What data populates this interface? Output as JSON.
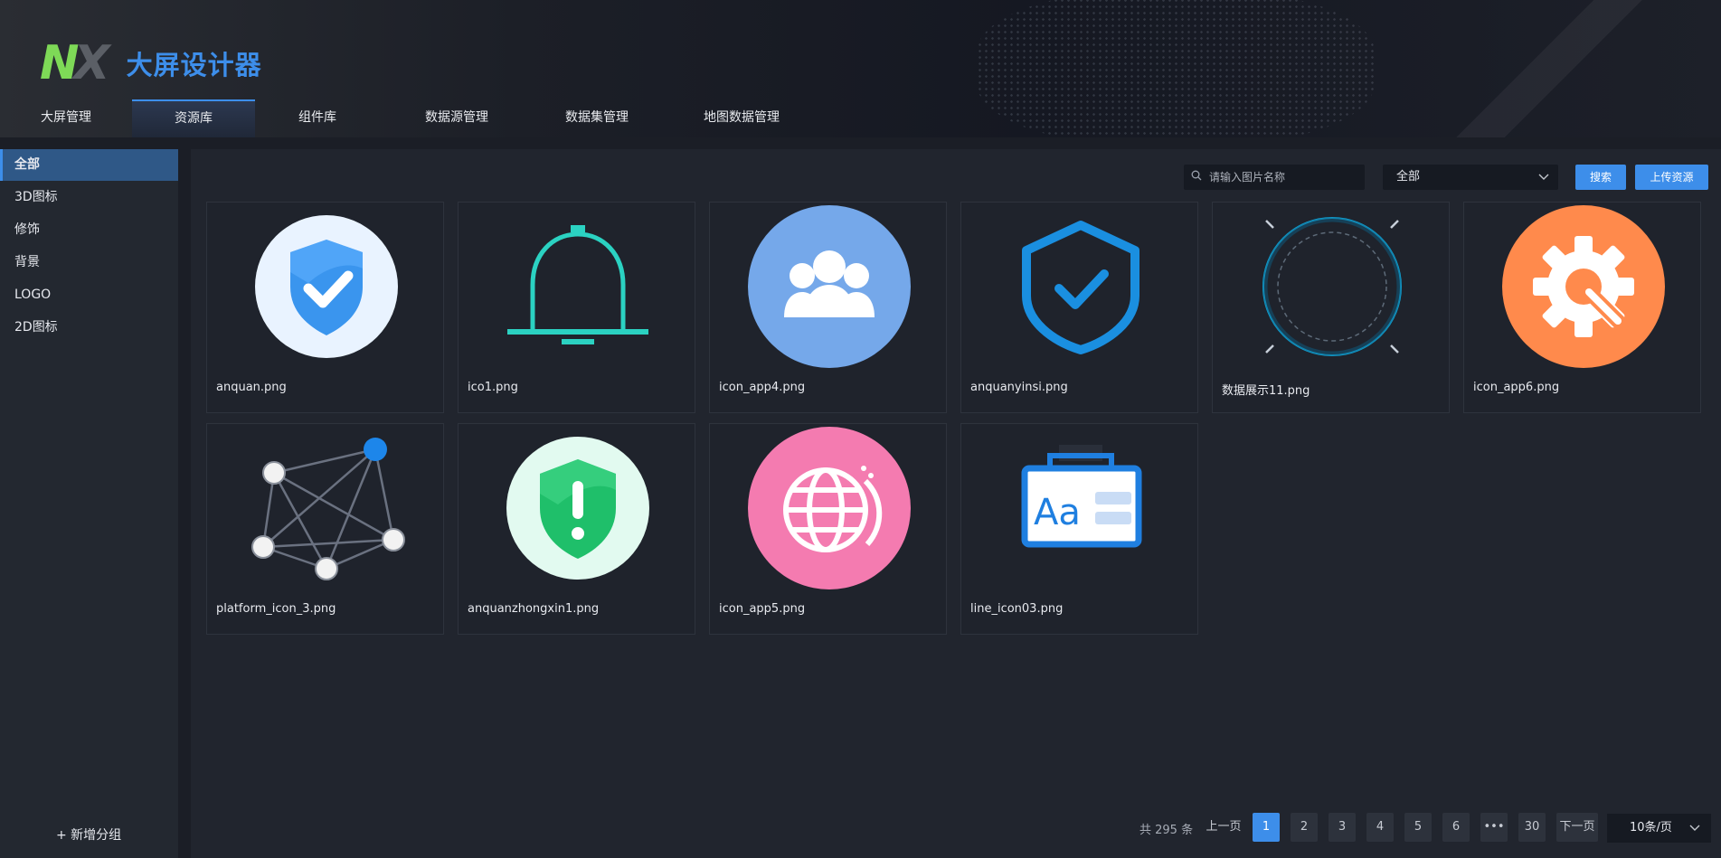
{
  "app": {
    "logo_n": "N",
    "logo_x": "X",
    "title": "大屏设计器"
  },
  "nav": {
    "tabs": [
      {
        "label": "大屏管理",
        "active": false
      },
      {
        "label": "资源库",
        "active": true
      },
      {
        "label": "组件库",
        "active": false
      },
      {
        "label": "数据源管理",
        "active": false
      },
      {
        "label": "数据集管理",
        "active": false
      },
      {
        "label": "地图数据管理",
        "active": false
      }
    ]
  },
  "sidebar": {
    "items": [
      {
        "label": "全部",
        "active": true
      },
      {
        "label": "3D图标",
        "active": false
      },
      {
        "label": "修饰",
        "active": false
      },
      {
        "label": "背景",
        "active": false
      },
      {
        "label": "LOGO",
        "active": false
      },
      {
        "label": "2D图标",
        "active": false
      }
    ],
    "add_group": "+ 新增分组"
  },
  "toolbar": {
    "search_placeholder": "请输入图片名称",
    "category_value": "全部",
    "search_button": "搜索",
    "upload_button": "上传资源"
  },
  "resources": [
    {
      "name": "anquan.png",
      "icon": "shield-check-icon"
    },
    {
      "name": "ico1.png",
      "icon": "bell-icon"
    },
    {
      "name": "icon_app4.png",
      "icon": "users-group-icon"
    },
    {
      "name": "anquanyinsi.png",
      "icon": "shield-outline-check-icon"
    },
    {
      "name": "数据展示11.png",
      "icon": "ring-frame-icon"
    },
    {
      "name": "icon_app6.png",
      "icon": "gear-wrench-icon"
    },
    {
      "name": "platform_icon_3.png",
      "icon": "network-graph-icon"
    },
    {
      "name": "anquanzhongxin1.png",
      "icon": "shield-alert-icon"
    },
    {
      "name": "icon_app5.png",
      "icon": "globe-icon"
    },
    {
      "name": "line_icon03.png",
      "icon": "font-card-icon"
    }
  ],
  "pagination": {
    "total_label": "共 295 条",
    "prev": "上一页",
    "next": "下一页",
    "pages": [
      "1",
      "2",
      "3",
      "4",
      "5",
      "6",
      "•••",
      "30"
    ],
    "current": "1",
    "page_size": "10条/页"
  },
  "colors": {
    "accent": "#3d8eea",
    "logo_green": "#7ed957"
  }
}
